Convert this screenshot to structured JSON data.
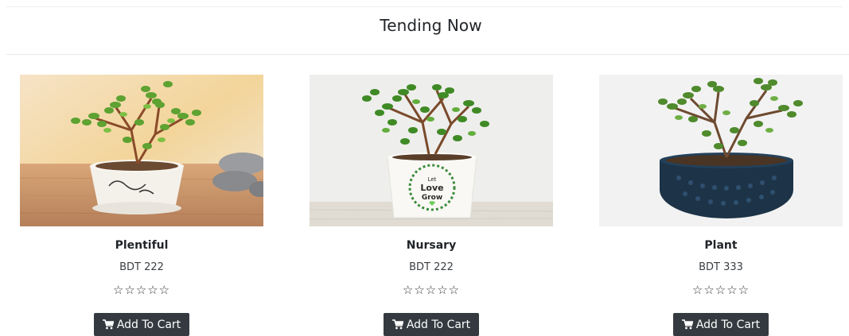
{
  "section": {
    "title": "Tending Now"
  },
  "products": [
    {
      "name": "Plentiful",
      "price": "BDT 222",
      "rating_stars": "☆☆☆☆☆",
      "button_label": "Add To Cart",
      "button_icon": "cart-icon"
    },
    {
      "name": "Nursary",
      "price": "BDT 222",
      "rating_stars": "☆☆☆☆☆",
      "button_label": "Add To Cart",
      "button_icon": "cart-icon",
      "pot_text": [
        "Let",
        "Love",
        "Grow"
      ]
    },
    {
      "name": "Plant",
      "price": "BDT 333",
      "rating_stars": "☆☆☆☆☆",
      "button_label": "Add To Cart",
      "button_icon": "cart-icon"
    }
  ],
  "colors": {
    "button_bg": "#343a40",
    "button_text": "#ffffff",
    "leaf_green": "#4f9a2c",
    "pot_navy": "#1d3347"
  }
}
